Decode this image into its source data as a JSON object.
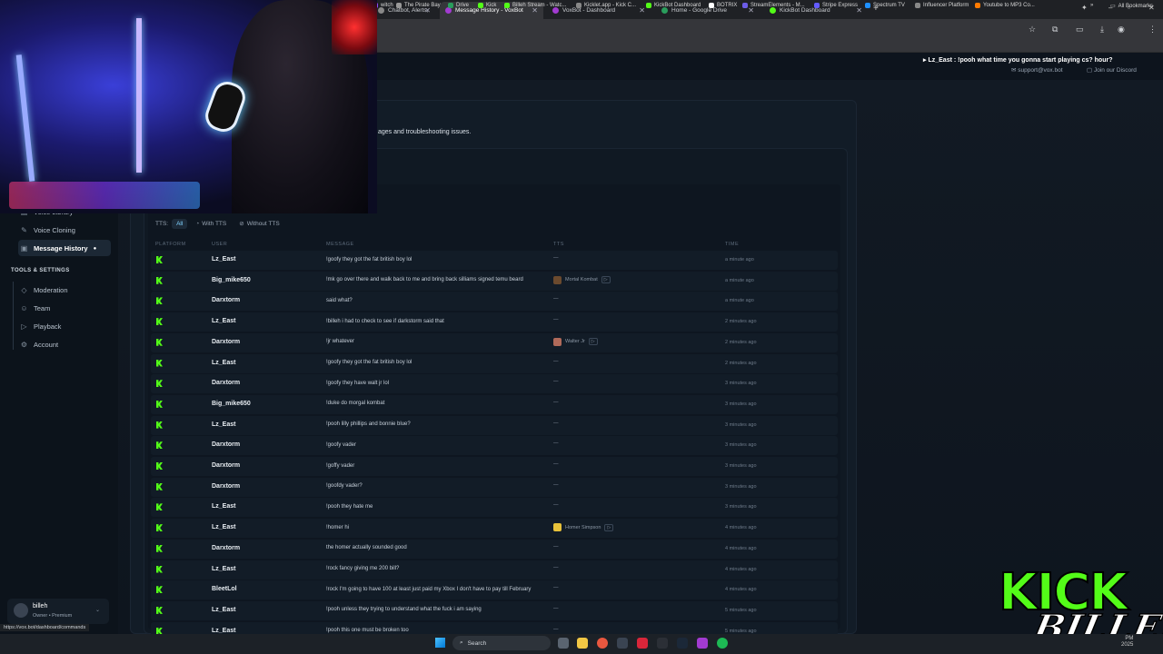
{
  "browser": {
    "tabs": [
      {
        "label": "Chatbot, Alerts,",
        "fav": "#888"
      },
      {
        "label": "Message History - VoxBot",
        "fav": "#a23bd1",
        "active": true
      },
      {
        "label": "VoxBot - Dashboard",
        "fav": "#a23bd1"
      },
      {
        "label": "Home - Google Drive",
        "fav": "#2a9d5c"
      },
      {
        "label": "KickBot Dashboard",
        "fav": "#53fc18"
      }
    ],
    "bookmarks": [
      {
        "label": "witch",
        "color": "#9146ff"
      },
      {
        "label": "The Pirate Bay",
        "color": "#999"
      },
      {
        "label": "Drive",
        "color": "#2a9d5c"
      },
      {
        "label": "Kick",
        "color": "#53fc18"
      },
      {
        "label": "Billeh Stream - Watc...",
        "color": "#53fc18"
      },
      {
        "label": "Kicklet.app - Kick C...",
        "color": "#888"
      },
      {
        "label": "KickBot Dashboard",
        "color": "#53fc18"
      },
      {
        "label": "BOTRIX",
        "color": "#fff"
      },
      {
        "label": "StreamElements - M...",
        "color": "#6c5ce7"
      },
      {
        "label": "Stripe Express",
        "color": "#635bff"
      },
      {
        "label": "Spectrum TV",
        "color": "#1e90ff"
      },
      {
        "label": "Influencer Platform",
        "color": "#888"
      },
      {
        "label": "Youtube to MP3 Co...",
        "color": "#ff7a00"
      }
    ],
    "all_bookmarks": "All Bookmarks"
  },
  "header": {
    "chat_message": "Lz_East : !pooh what time you gonna start playing cs? hour?",
    "support": "support@vox.bot",
    "discord": "Join our Discord"
  },
  "page": {
    "subtitle": "ages and troubleshooting issues."
  },
  "filter": {
    "label": "TTS:",
    "options": [
      "All",
      "With TTS",
      "Without TTS"
    ]
  },
  "columns": {
    "platform": "PLATFORM",
    "user": "USER",
    "message": "MESSAGE",
    "tts": "TTS",
    "time": "TIME"
  },
  "rows": [
    {
      "user": "Lz_East",
      "message": "!goofy they got the fat british boy lol",
      "tts": "—",
      "time": "a minute ago"
    },
    {
      "user": "Big_mike650",
      "message": "!mk go over there and walk back to me and bring back silliams signed temu beard",
      "tts": "Mortal Kombat",
      "tts_color": "#6b4a2e",
      "time": "a minute ago"
    },
    {
      "user": "Darxtorm",
      "message": "said what?",
      "tts": "—",
      "time": "a minute ago"
    },
    {
      "user": "Lz_East",
      "message": "!billeh i had to check to see if darkstorm said that",
      "tts": "—",
      "time": "2 minutes ago"
    },
    {
      "user": "Darxtorm",
      "message": "!jr whatever",
      "tts": "Walter Jr",
      "tts_color": "#b06a5a",
      "time": "2 minutes ago"
    },
    {
      "user": "Lz_East",
      "message": "!goofy they got the fat british boy lol",
      "tts": "—",
      "time": "2 minutes ago"
    },
    {
      "user": "Darxtorm",
      "message": "!goofy they have walt jr lol",
      "tts": "—",
      "time": "3 minutes ago"
    },
    {
      "user": "Big_mike650",
      "message": "!duke do morgal kombat",
      "tts": "—",
      "time": "3 minutes ago"
    },
    {
      "user": "Lz_East",
      "message": "!pooh lilly phillips and bonnie blue?",
      "tts": "—",
      "time": "3 minutes ago"
    },
    {
      "user": "Darxtorm",
      "message": "!goofy vader",
      "tts": "—",
      "time": "3 minutes ago"
    },
    {
      "user": "Darxtorm",
      "message": "!goffy vader",
      "tts": "—",
      "time": "3 minutes ago"
    },
    {
      "user": "Darxtorm",
      "message": "!goofdy vader?",
      "tts": "—",
      "time": "3 minutes ago"
    },
    {
      "user": "Lz_East",
      "message": "!pooh they hate me",
      "tts": "—",
      "time": "3 minutes ago"
    },
    {
      "user": "Lz_East",
      "message": "!homer hi",
      "tts": "Homer Simpson",
      "tts_color": "#e8c23a",
      "time": "4 minutes ago"
    },
    {
      "user": "Darxtorm",
      "message": "the homer actually sounded good",
      "tts": "—",
      "time": "4 minutes ago"
    },
    {
      "user": "Lz_East",
      "message": "!rock fancy giving me 200 bill?",
      "tts": "—",
      "time": "4 minutes ago"
    },
    {
      "user": "BleetLol",
      "message": "!rock I'm going to have 100 at least just paid my Xbox I don't have to pay till February",
      "tts": "—",
      "time": "4 minutes ago"
    },
    {
      "user": "Lz_East",
      "message": "!pooh unless they trying to understand what the fuck i am saying",
      "tts": "—",
      "time": "5 minutes ago"
    },
    {
      "user": "Lz_East",
      "message": "!pooh this one must be broken too",
      "tts": "—",
      "time": "5 minutes ago"
    }
  ],
  "sidebar": {
    "items_top": [
      "Voice Library",
      "Voice Cloning",
      "Message History"
    ],
    "section": "TOOLS & SETTINGS",
    "items_tools": [
      "Moderation",
      "Team",
      "Playback",
      "Account"
    ],
    "user_name": "billeh",
    "user_role": "Owner • Premium"
  },
  "status_url": "https://vox.bot/dashboard/commands",
  "overlay": {
    "kick": "KICK",
    "billeh": "BILLEH"
  },
  "taskbar": {
    "search": "Search",
    "time": "PM",
    "date": "2025"
  }
}
